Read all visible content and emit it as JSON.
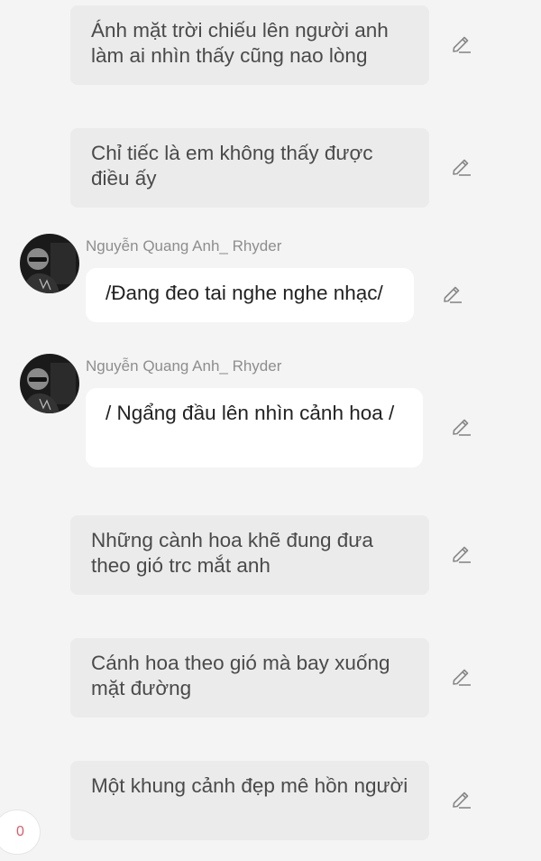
{
  "messages": [
    {
      "kind": "narration",
      "text": "Ánh mặt trời chiếu lên người anh làm ai nhìn thấy cũng nao lòng"
    },
    {
      "kind": "narration",
      "text": "Chỉ tiếc là em không thấy được điều ấy"
    },
    {
      "kind": "chat",
      "author": "Nguyễn Quang Anh_ Rhyder",
      "text": "/Đang đeo tai nghe nghe nhạc/"
    },
    {
      "kind": "chat",
      "author": "Nguyễn Quang Anh_ Rhyder",
      "text": "/ Ngẩng đầu lên nhìn cảnh hoa /"
    },
    {
      "kind": "narration",
      "text": "Những cành hoa khẽ đung đưa theo gió trc mắt anh"
    },
    {
      "kind": "narration",
      "text": "Cánh hoa theo gió mà bay xuống mặt đường"
    },
    {
      "kind": "narration",
      "text": "Một khung cảnh đẹp mê hồn người"
    }
  ],
  "counter": {
    "value": "0"
  },
  "icons": {
    "edit": "pencil-icon",
    "avatar": "avatar-image"
  }
}
